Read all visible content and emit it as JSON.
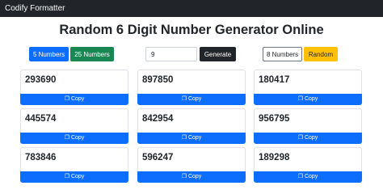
{
  "navbar": {
    "brand": "Codify Formatter"
  },
  "page": {
    "title": "Random 6 Digit Number Generator Online"
  },
  "controls": {
    "five_numbers_label": "5 Numbers",
    "twenty_five_numbers_label": "25 Numbers",
    "count_value": "9",
    "generate_label": "Generate",
    "eight_numbers_label": "8 Numbers",
    "random_label": "Random"
  },
  "copy_label": "Copy",
  "copy_icon": "copy-icon",
  "colors": {
    "primary": "#0d6efd",
    "success": "#198754",
    "dark": "#212529",
    "warning": "#ffc107"
  },
  "numbers": [
    "293690",
    "897850",
    "180417",
    "445574",
    "842954",
    "956795",
    "783846",
    "596247",
    "189298"
  ]
}
